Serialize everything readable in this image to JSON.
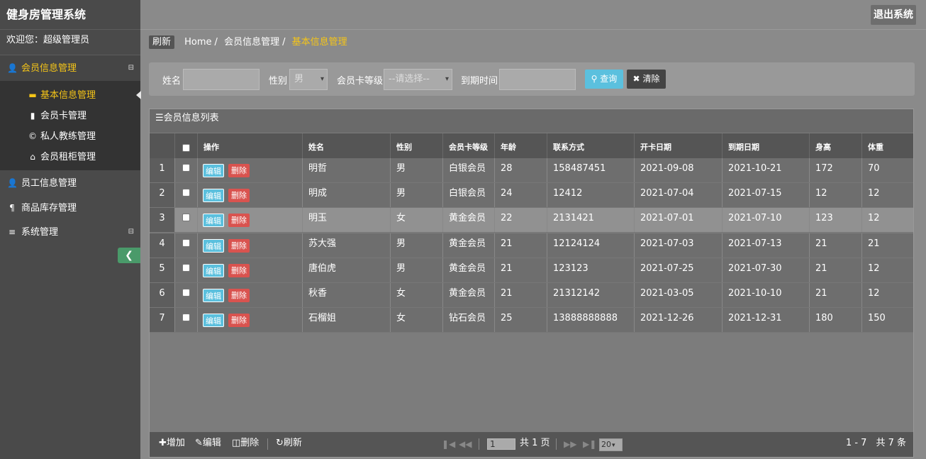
{
  "app": {
    "title": "健身房管理系统",
    "welcome": "欢迎您：超级管理员",
    "logout": "退出系统"
  },
  "sidebar": {
    "groups": [
      {
        "label": "会员信息管理",
        "icon": "user-icon",
        "toggle": "⊟"
      },
      {
        "label": "员工信息管理",
        "icon": "user-icon"
      },
      {
        "label": "商品库存管理",
        "icon": "cutlery-icon"
      },
      {
        "label": "系统管理",
        "icon": "list-icon",
        "toggle": "⊟"
      }
    ],
    "sub_items": [
      {
        "label": "基本信息管理",
        "icon": "folder-icon"
      },
      {
        "label": "会员卡管理",
        "icon": "book-icon"
      },
      {
        "label": "私人教练管理",
        "icon": "copyright-icon"
      },
      {
        "label": "会员租柜管理",
        "icon": "home-icon"
      }
    ]
  },
  "breadcrumb": {
    "refresh": "刷新",
    "home": "Home",
    "sep": "/",
    "parent": "会员信息管理",
    "current": "基本信息管理"
  },
  "search": {
    "name_label": "姓名",
    "name_value": "",
    "gender_label": "性别",
    "gender_value": "男",
    "card_label": "会员卡等级",
    "card_value": "--请选择--",
    "expire_label": "到期时间",
    "expire_value": "",
    "query": "查询",
    "clear": "清除"
  },
  "grid": {
    "title": "会员信息列表",
    "headers": [
      "操作",
      "姓名",
      "性别",
      "会员卡等级",
      "年龄",
      "联系方式",
      "开卡日期",
      "到期日期",
      "身高",
      "体重"
    ],
    "edit": "编辑",
    "delete": "删除",
    "rows": [
      {
        "n": "1",
        "name": "明哲",
        "gender": "男",
        "card": "白银会员",
        "age": "28",
        "phone": "158487451",
        "start": "2021-09-08",
        "end": "2021-10-21",
        "height": "172",
        "weight": "70"
      },
      {
        "n": "2",
        "name": "明成",
        "gender": "男",
        "card": "白银会员",
        "age": "24",
        "phone": "12412",
        "start": "2021-07-04",
        "end": "2021-07-15",
        "height": "12",
        "weight": "12"
      },
      {
        "n": "3",
        "name": "明玉",
        "gender": "女",
        "card": "黄金会员",
        "age": "22",
        "phone": "2131421",
        "start": "2021-07-01",
        "end": "2021-07-10",
        "height": "123",
        "weight": "12"
      },
      {
        "n": "4",
        "name": "苏大强",
        "gender": "男",
        "card": "黄金会员",
        "age": "21",
        "phone": "12124124",
        "start": "2021-07-03",
        "end": "2021-07-13",
        "height": "21",
        "weight": "21"
      },
      {
        "n": "5",
        "name": "唐伯虎",
        "gender": "男",
        "card": "黄金会员",
        "age": "21",
        "phone": "123123",
        "start": "2021-07-25",
        "end": "2021-07-30",
        "height": "21",
        "weight": "12"
      },
      {
        "n": "6",
        "name": "秋香",
        "gender": "女",
        "card": "黄金会员",
        "age": "21",
        "phone": "21312142",
        "start": "2021-03-05",
        "end": "2021-10-10",
        "height": "21",
        "weight": "12"
      },
      {
        "n": "7",
        "name": "石榴姐",
        "gender": "女",
        "card": "钻石会员",
        "age": "25",
        "phone": "13888888888",
        "start": "2021-12-26",
        "end": "2021-12-31",
        "height": "180",
        "weight": "150"
      }
    ]
  },
  "toolbar": {
    "add": "增加",
    "edit": "编辑",
    "delete": "删除",
    "refresh": "刷新",
    "page_value": "1",
    "page_total": "共 1 页",
    "page_size": "20",
    "info": "1 - 7　共 7 条"
  }
}
